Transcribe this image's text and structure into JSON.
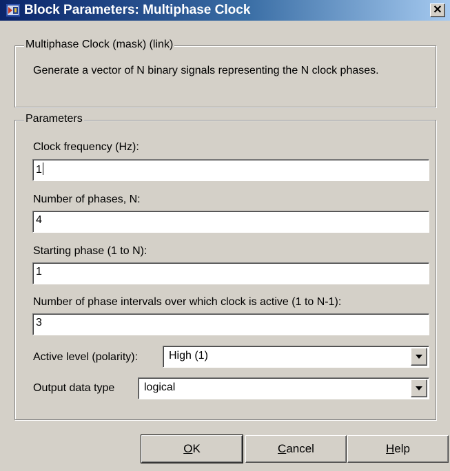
{
  "window": {
    "title": "Block Parameters: Multiphase Clock"
  },
  "mask_group": {
    "label": "Multiphase Clock (mask) (link)",
    "description": "Generate a vector of N binary signals representing the N clock phases."
  },
  "parameters_group": {
    "label": "Parameters",
    "fields": [
      {
        "label": "Clock frequency (Hz):",
        "value": "1"
      },
      {
        "label": "Number of phases, N:",
        "value": "4"
      },
      {
        "label": "Starting phase (1 to N):",
        "value": "1"
      },
      {
        "label": "Number of phase intervals over which clock is active (1 to N-1):",
        "value": "3"
      }
    ],
    "active_level": {
      "label": "Active level (polarity):",
      "selected": "High (1)"
    },
    "output_type": {
      "label": "Output data type",
      "selected": "logical"
    }
  },
  "buttons": {
    "ok": {
      "mnemonic": "O",
      "rest": "K"
    },
    "cancel": {
      "mnemonic": "C",
      "rest": "ancel"
    },
    "help": {
      "mnemonic": "H",
      "rest": "elp"
    }
  },
  "colors": {
    "title_start": "#0a246a",
    "title_end": "#a6caf0",
    "face": "#d4d0c8"
  },
  "icons": {
    "app": "simulink-block-icon",
    "close": "close-icon",
    "dropdown": "chevron-down-icon"
  }
}
